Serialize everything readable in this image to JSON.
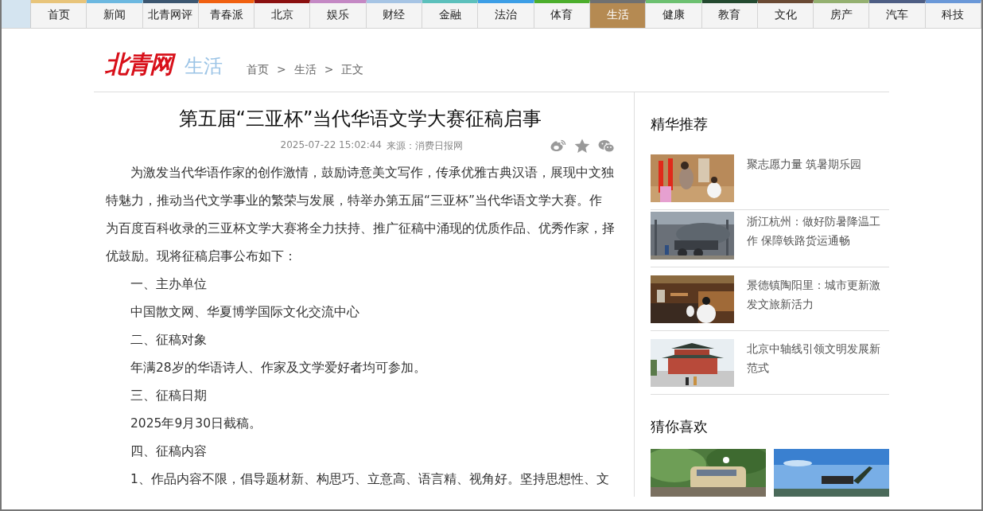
{
  "nav": {
    "tabs": [
      {
        "label": "首页",
        "color": "#e8c47a",
        "selected": false
      },
      {
        "label": "新闻",
        "color": "#6cb8e0",
        "selected": false
      },
      {
        "label": "北青网评",
        "color": "#3c5670",
        "selected": false
      },
      {
        "label": "青春派",
        "color": "#f06010",
        "selected": false
      },
      {
        "label": "北京",
        "color": "#8b1010",
        "selected": false
      },
      {
        "label": "娱乐",
        "color": "#c488c4",
        "selected": false
      },
      {
        "label": "财经",
        "color": "#a6c4e4",
        "selected": false
      },
      {
        "label": "金融",
        "color": "#5cc0bc",
        "selected": false
      },
      {
        "label": "法治",
        "color": "#3c9ee6",
        "selected": false
      },
      {
        "label": "体育",
        "color": "#4cae2c",
        "selected": false
      },
      {
        "label": "生活",
        "color": "#707070",
        "selected": true
      },
      {
        "label": "健康",
        "color": "#6cc070",
        "selected": false
      },
      {
        "label": "教育",
        "color": "#244a30",
        "selected": false
      },
      {
        "label": "文化",
        "color": "#6a4a34",
        "selected": false
      },
      {
        "label": "房产",
        "color": "#94b070",
        "selected": false
      },
      {
        "label": "汽车",
        "color": "#4e5e84",
        "selected": false
      },
      {
        "label": "科技",
        "color": "#6a98d8",
        "selected": false
      }
    ]
  },
  "header": {
    "logo": "北青网",
    "section": "生活",
    "breadcrumb": [
      "首页",
      "生活",
      "正文"
    ],
    "separator": ">"
  },
  "article": {
    "title": "第五届“三亚杯”当代华语文学大赛征稿启事",
    "date": "2025-07-22 15:02:44",
    "source": "来源：消费日报网",
    "paragraphs": [
      "为激发当代华语作家的创作激情，鼓励诗意美文写作，传承优雅古典汉语，展现中文独特魅力，推动当代文学事业的繁荣与发展，特举办第五届“三亚杯”当代华语文学大赛。作为百度百科收录的三亚杯文学大赛将全力扶持、推广征稿中涌现的优质作品、优秀作家，择优鼓励。现将征稿启事公布如下：",
      "一、主办单位",
      "中国散文网、华夏博学国际文化交流中心",
      "二、征稿对象",
      "年满28岁的华语诗人、作家及文学爱好者均可参加。",
      "三、征稿日期",
      "2025年9月30日截稿。",
      "四、征稿内容",
      "1、作品内容不限，倡导题材新、构思巧、立意高、语言精、视角好。坚持思想性、文"
    ]
  },
  "sidebar": {
    "featured": {
      "title": "精华推荐",
      "items": [
        {
          "title": "聚志愿力量 筑暑期乐园"
        },
        {
          "title": "浙江杭州：做好防暑降温工作 保障铁路货运通畅"
        },
        {
          "title": "景德镇陶阳里：城市更新激发文旅新活力"
        },
        {
          "title": "北京中轴线引领文明发展新范式"
        }
      ]
    },
    "guess": {
      "title": "猜你喜欢"
    }
  }
}
